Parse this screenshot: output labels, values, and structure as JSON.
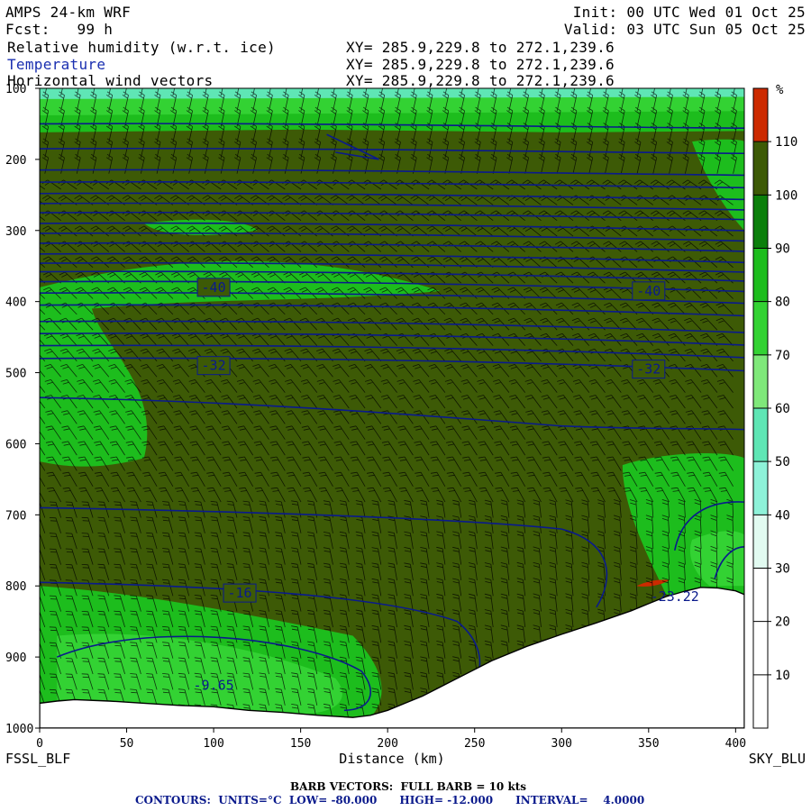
{
  "header": {
    "model": "AMPS 24-km WRF",
    "fcst": "Fcst:   99 h",
    "init": "Init: 00 UTC Wed 01 Oct 25",
    "valid": "Valid: 03 UTC Sun 05 Oct 25",
    "fields": [
      {
        "name": "Relative humidity (w.r.t. ice)",
        "xy": "XY= 285.9,229.8 to 272.1,239.6",
        "color": "#000000"
      },
      {
        "name": "Temperature",
        "xy": "XY= 285.9,229.8 to 272.1,239.6",
        "color": "#1a2fb0"
      },
      {
        "name": "Horizontal wind vectors",
        "xy": "XY= 285.9,229.8 to 272.1,239.6",
        "color": "#000000"
      }
    ]
  },
  "footer": {
    "barb": "BARB VECTORS:  FULL BARB = 10 kts",
    "contours": "CONTOURS:  UNITS=°C  LOW= -80.000      HIGH= -12.000      INTERVAL=    4.0000"
  },
  "colorbar": {
    "unit": "%",
    "ticks": [
      "10",
      "20",
      "30",
      "40",
      "50",
      "60",
      "70",
      "80",
      "90",
      "100",
      "110"
    ],
    "colors": [
      "#ffffff",
      "#ffffff",
      "#ffffff",
      "#e2fbf1",
      "#8ef2d9",
      "#5fe6b5",
      "#7fe87a",
      "#33d233",
      "#1dbd1d",
      "#0b7f0b",
      "#3d5a06",
      "#cc2a00"
    ]
  },
  "chart_data": {
    "type": "cross-section",
    "x_label": "Distance (km)",
    "x_ticks": [
      0,
      50,
      100,
      150,
      200,
      250,
      300,
      350,
      400
    ],
    "y_ticks": [
      100,
      200,
      300,
      400,
      500,
      600,
      700,
      800,
      900,
      1000
    ],
    "xlim": [
      0,
      405
    ],
    "ylim": [
      100,
      1000
    ],
    "left_label": "FSSL_BLF",
    "right_label": "SKY_BLU",
    "fill_colors": {
      "base": "#3d5a06",
      "green": "#1dbd1d",
      "bright": "#33d233",
      "dark": "#0b7f0b",
      "cyan": "#5fe6b5",
      "red": "#cc2a00"
    },
    "contour_color": "#0a1a8c",
    "contour_labels": [
      {
        "text": "-40",
        "x": 100,
        "y": 380
      },
      {
        "text": "-40",
        "x": 350,
        "y": 385
      },
      {
        "text": "-32",
        "x": 100,
        "y": 490
      },
      {
        "text": "-32",
        "x": 350,
        "y": 495
      },
      {
        "text": "-16",
        "x": 115,
        "y": 810
      },
      {
        "text": "-9.65",
        "x": 100,
        "y": 940
      },
      {
        "text": "-23.22",
        "x": 365,
        "y": 815
      }
    ],
    "terrain_km": [
      0,
      10,
      20,
      40,
      60,
      80,
      100,
      120,
      140,
      160,
      180,
      190,
      200,
      210,
      220,
      240,
      260,
      280,
      300,
      320,
      340,
      350,
      360,
      370,
      380,
      390,
      400,
      405
    ],
    "terrain_p": [
      965,
      962,
      960,
      962,
      965,
      968,
      970,
      975,
      978,
      982,
      985,
      982,
      975,
      965,
      955,
      930,
      905,
      885,
      868,
      852,
      835,
      825,
      815,
      808,
      802,
      803,
      807,
      812
    ]
  }
}
